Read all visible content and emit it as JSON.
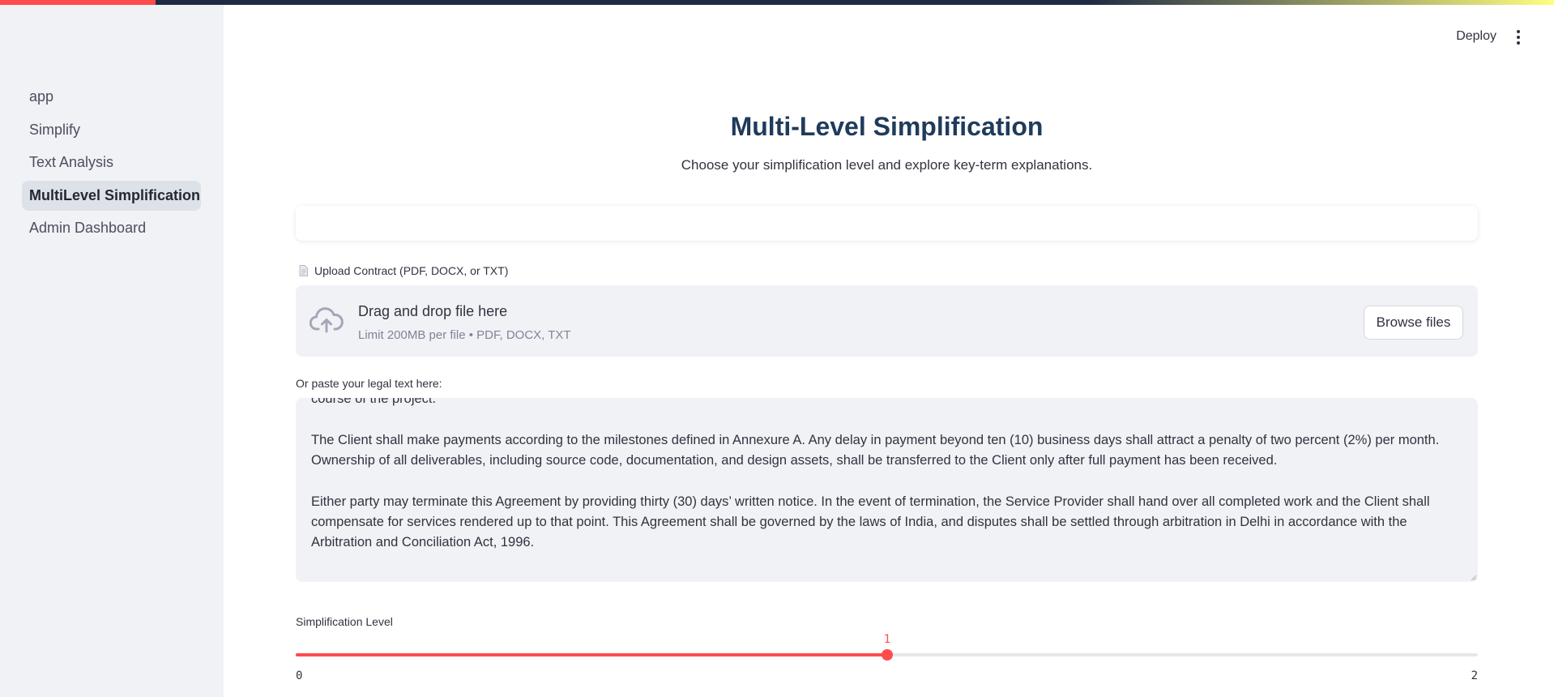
{
  "sidebar": {
    "items": [
      {
        "label": "app",
        "active": false
      },
      {
        "label": "Simplify",
        "active": false
      },
      {
        "label": "Text Analysis",
        "active": false
      },
      {
        "label": "MultiLevel Simplification",
        "active": true
      },
      {
        "label": "Admin Dashboard",
        "active": false
      }
    ]
  },
  "header": {
    "deploy_label": "Deploy",
    "menu_icon": "kebab-vertical-icon"
  },
  "page": {
    "title": "Multi-Level Simplification",
    "subtitle": "Choose your simplification level and explore key-term explanations."
  },
  "upload": {
    "label": "Upload Contract (PDF, DOCX, or TXT)",
    "label_icon": "document-icon",
    "drop_title": "Drag and drop file here",
    "drop_limit": "Limit 200MB per file • PDF, DOCX, TXT",
    "browse_label": "Browse files",
    "cloud_icon": "cloud-upload-icon"
  },
  "paste": {
    "label": "Or paste your legal text here:",
    "paragraphs": [
      "course of the project.",
      "The Client shall make payments according to the milestones defined in Annexure A. Any delay in payment beyond ten (10) business days shall attract a penalty of two percent (2%) per month. Ownership of all deliverables, including source code, documentation, and design assets, shall be transferred to the Client only after full payment has been received.",
      "Either party may terminate this Agreement by providing thirty (30) days’ written notice. In the event of termination, the Service Provider shall hand over all completed work and the Client shall compensate for services rendered up to that point. This Agreement shall be governed by the laws of India, and disputes shall be settled through arbitration in Delhi in accordance with the Arbitration and Conciliation Act, 1996."
    ]
  },
  "slider": {
    "label": "Simplification Level",
    "min": 0,
    "max": 2,
    "value": 1,
    "min_label": "0",
    "max_label": "2",
    "value_label": "1"
  },
  "colors": {
    "accent": "#ff4b4b",
    "title": "#1f3b5c",
    "sidebar_bg": "#f0f2f6"
  }
}
